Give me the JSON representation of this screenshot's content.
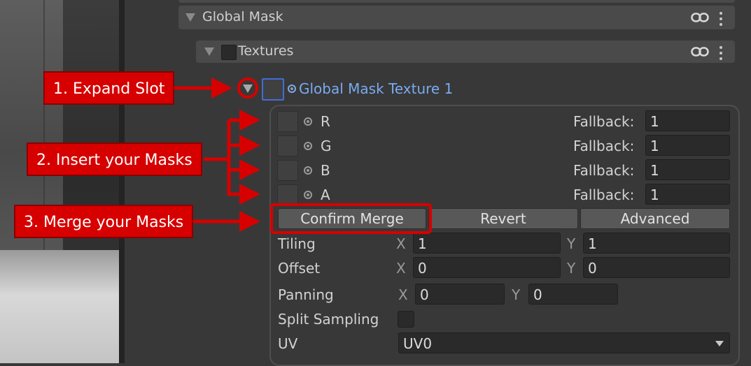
{
  "inspector": {
    "global_mask": {
      "label": "Global Mask"
    },
    "textures": {
      "label": "Textures"
    },
    "slot": {
      "label": "Global Mask Texture 1"
    },
    "channels": [
      {
        "label": "R",
        "fallback_label": "Fallback:",
        "fallback_value": "1"
      },
      {
        "label": "G",
        "fallback_label": "Fallback:",
        "fallback_value": "1"
      },
      {
        "label": "B",
        "fallback_label": "Fallback:",
        "fallback_value": "1"
      },
      {
        "label": "A",
        "fallback_label": "Fallback:",
        "fallback_value": "1"
      }
    ],
    "buttons": {
      "confirm_merge": "Confirm Merge",
      "revert": "Revert",
      "advanced": "Advanced"
    },
    "tiling": {
      "label": "Tiling",
      "x_label": "X",
      "x": "1",
      "y_label": "Y",
      "y": "1"
    },
    "offset": {
      "label": "Offset",
      "x_label": "X",
      "x": "0",
      "y_label": "Y",
      "y": "0"
    },
    "panning": {
      "label": "Panning",
      "x_label": "X",
      "x": "0",
      "y_label": "Y",
      "y": "0"
    },
    "split_sampling": {
      "label": "Split Sampling",
      "checked": false
    },
    "uv": {
      "label": "UV",
      "value": "UV0"
    }
  },
  "annotations": {
    "step1": "1. Expand Slot",
    "step2": "2. Insert your Masks",
    "step3": "3. Merge your Masks",
    "color": "#d60000"
  },
  "icons": [
    "foldout-triangle-icon",
    "link-icon",
    "kebab-menu-icon",
    "object-picker-icon",
    "dropdown-arrow-icon"
  ],
  "colors": {
    "accent_blue": "#7aaaf0",
    "slot_border_blue": "#3f6fd6",
    "annotation_red": "#d60000"
  }
}
